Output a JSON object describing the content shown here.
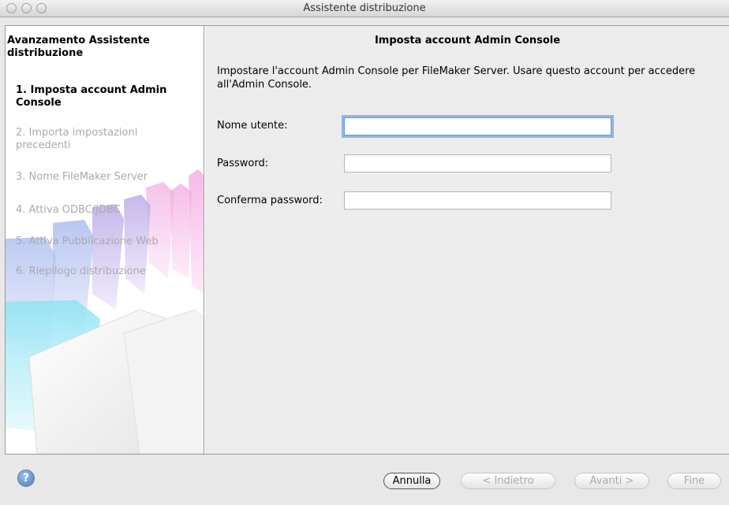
{
  "window": {
    "title": "Assistente distribuzione"
  },
  "sidebar": {
    "title": "Avanzamento Assistente distribuzione",
    "steps": [
      {
        "label": "1. Imposta account Admin Console",
        "state": "active"
      },
      {
        "label": "2. Importa impostazioni precedenti",
        "state": "pending"
      },
      {
        "label": "3. Nome FileMaker Server",
        "state": "pending"
      },
      {
        "label": "4. Attiva ODBC/JDBC",
        "state": "pending"
      },
      {
        "label": "5. Attiva Pubblicazione Web",
        "state": "pending"
      },
      {
        "label": "6. Riepilogo distribuzione",
        "state": "pending"
      }
    ]
  },
  "main": {
    "title": "Imposta account Admin Console",
    "description": "Impostare l'account Admin Console per FileMaker Server. Usare questo account per accedere all'Admin Console.",
    "fields": {
      "username": {
        "label": "Nome utente:",
        "value": ""
      },
      "password": {
        "label": "Password:",
        "value": ""
      },
      "confirm": {
        "label": "Conferma password:",
        "value": ""
      }
    }
  },
  "footer": {
    "help_icon": "question-icon",
    "help_glyph": "?",
    "cancel": "Annulla",
    "back": "< Indietro",
    "next": "Avanti >",
    "finish": "Fine"
  },
  "colors": {
    "focus_ring": "#8fb4e6",
    "panel_bg": "#ececec"
  }
}
